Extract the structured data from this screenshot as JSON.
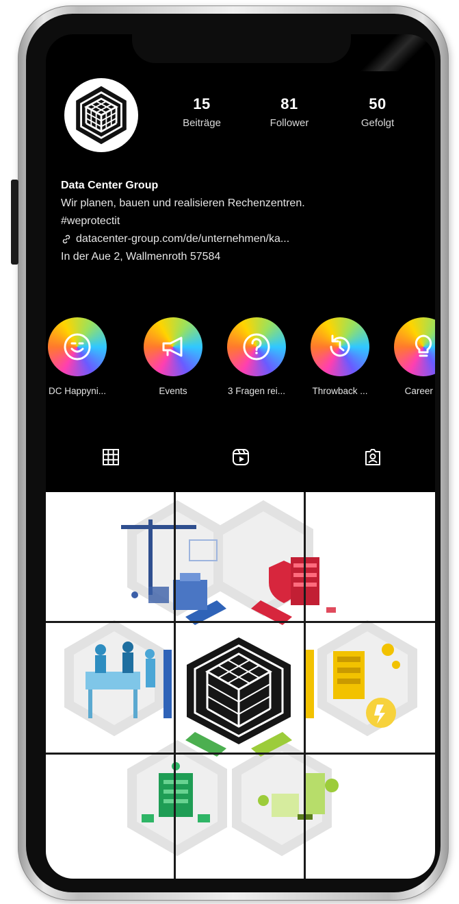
{
  "profile": {
    "name": "Data Center Group",
    "bio_line1": "Wir planen, bauen und realisieren Rechenzentren.",
    "bio_line2": "#weprotectit",
    "link": "datacenter-group.com/de/unternehmen/ka...",
    "address": "In der Aue 2, Wallmenroth 57584"
  },
  "stats": [
    {
      "value": "15",
      "label": "Beiträge"
    },
    {
      "value": "81",
      "label": "Follower"
    },
    {
      "value": "50",
      "label": "Gefolgt"
    }
  ],
  "highlights": [
    {
      "label": "DC Happyni...",
      "icon": "smiley-icon"
    },
    {
      "label": "Events",
      "icon": "megaphone-icon"
    },
    {
      "label": "3 Fragen rei...",
      "icon": "question-icon"
    },
    {
      "label": "Throwback ...",
      "icon": "history-icon"
    },
    {
      "label": "Career H",
      "icon": "lightbulb-icon"
    }
  ],
  "tabs": [
    {
      "name": "posts-grid",
      "icon": "grid-icon",
      "active": true
    },
    {
      "name": "reels",
      "icon": "reels-icon",
      "active": false
    },
    {
      "name": "tagged",
      "icon": "tagged-user-icon",
      "active": false
    }
  ],
  "colors": {
    "background": "#000000",
    "frame": "#c8c8c8",
    "hex_red": "#d7263d",
    "hex_blue": "#2f63b8",
    "hex_yellow": "#f2c200",
    "hex_green": "#4caf50",
    "hex_lime": "#9ccc3a"
  }
}
